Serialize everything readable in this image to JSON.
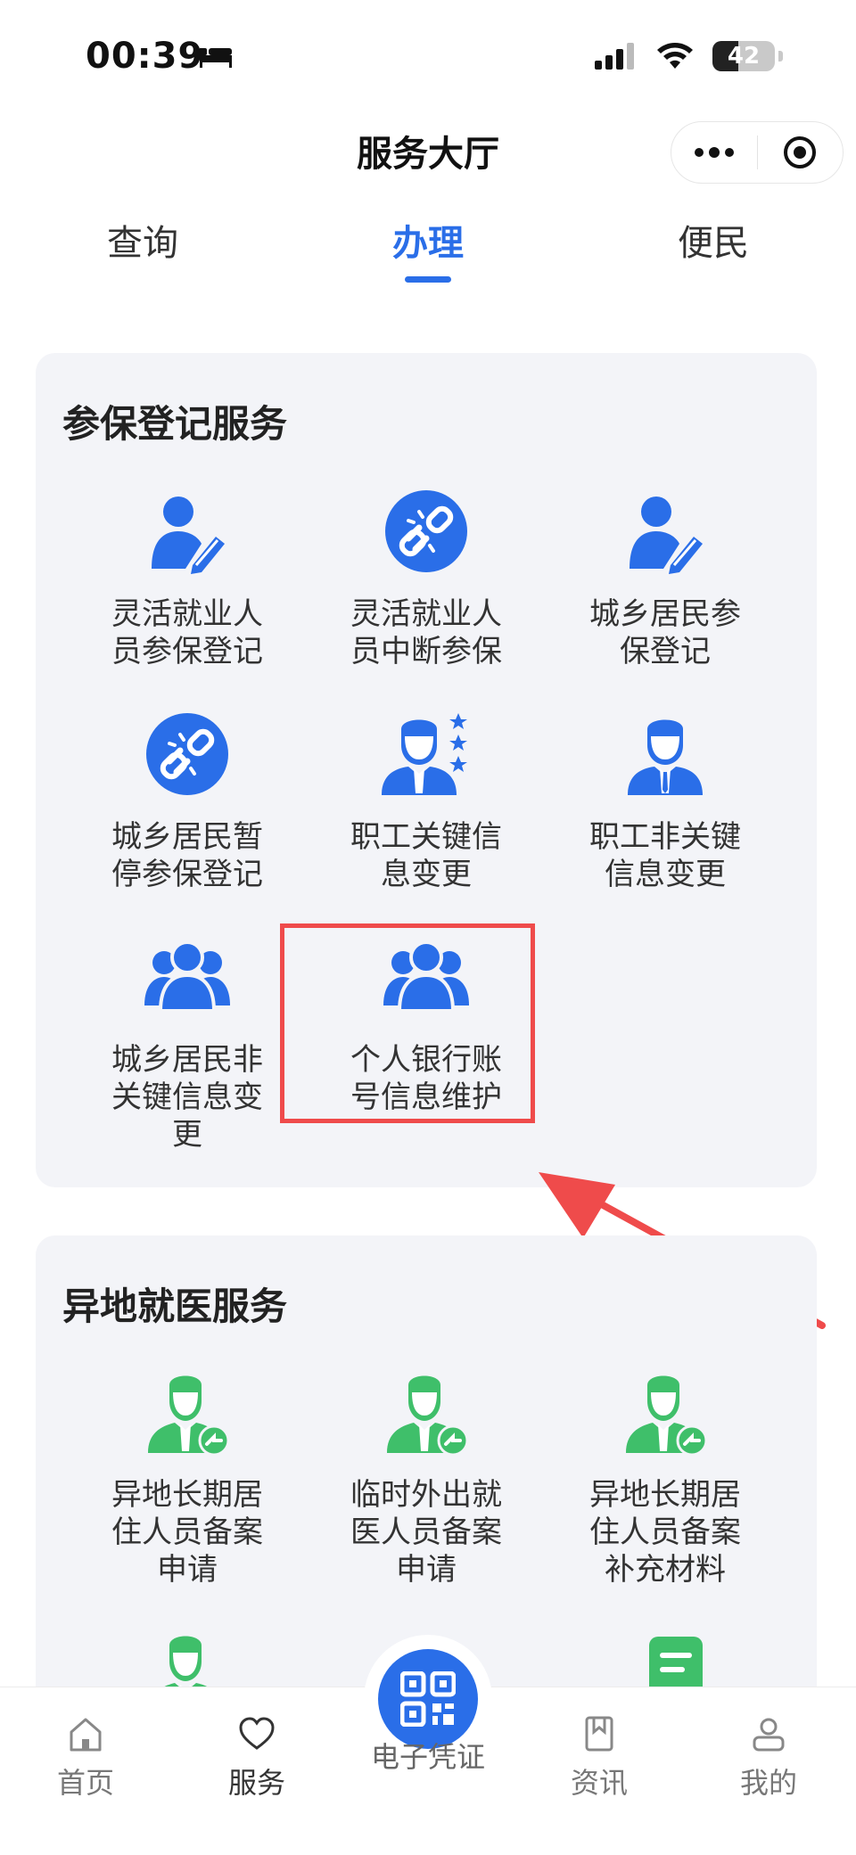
{
  "status_bar": {
    "time": "00:39",
    "battery": "42"
  },
  "nav": {
    "title": "服务大厅",
    "more_icon": "more-dots-icon",
    "close_icon": "target-icon"
  },
  "tabs": [
    {
      "label": "查询"
    },
    {
      "label": "办理",
      "active": true
    },
    {
      "label": "便民"
    }
  ],
  "sections": [
    {
      "title": "参保登记服务",
      "items": [
        {
          "label": "灵活就业人员参保登记",
          "icon": "user-edit-icon"
        },
        {
          "label": "灵活就业人员中断参保",
          "icon": "broken-link-icon"
        },
        {
          "label": "城乡居民参保登记",
          "icon": "user-edit-icon"
        },
        {
          "label": "城乡居民暂停参保登记",
          "icon": "broken-link-icon"
        },
        {
          "label": "职工关键信息变更",
          "icon": "staff-star-icon"
        },
        {
          "label": "职工非关键信息变更",
          "icon": "staff-icon"
        },
        {
          "label": "城乡居民非关键信息变更",
          "icon": "group-icon"
        },
        {
          "label": "个人银行账号信息维护",
          "icon": "group-icon",
          "highlighted": true
        }
      ]
    },
    {
      "title": "异地就医服务",
      "items": [
        {
          "label": "异地长期居住人员备案申请",
          "icon": "green-staff-icon"
        },
        {
          "label": "临时外出就医人员备案申请",
          "icon": "green-staff-icon"
        },
        {
          "label": "异地长期居住人员备案补充材料",
          "icon": "green-staff-icon"
        }
      ]
    }
  ],
  "bottom_tabs": [
    {
      "label": "首页",
      "icon": "home-icon"
    },
    {
      "label": "服务",
      "icon": "heart-icon",
      "active": true
    },
    {
      "label": "电子凭证",
      "icon": "qr-code-icon"
    },
    {
      "label": "资讯",
      "icon": "news-bookmark-icon"
    },
    {
      "label": "我的",
      "icon": "user-icon"
    }
  ],
  "colors": {
    "accent": "#2a6ee8",
    "green": "#3fbf6a",
    "highlight": "#ef4b4b",
    "card_bg": "#f3f4f8"
  }
}
